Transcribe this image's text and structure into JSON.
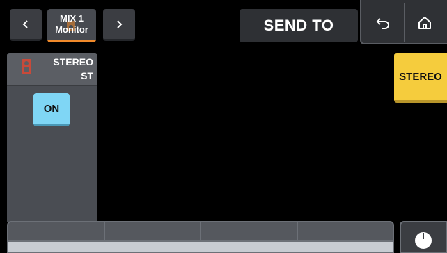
{
  "header": {
    "channel_line1": "MIX 1",
    "channel_line2": "Monitor",
    "title": "SEND TO"
  },
  "icons": {
    "prev": "chevron-left-icon",
    "next": "chevron-right-icon",
    "back": "undo-arrow-icon",
    "home": "home-icon",
    "speaker": "speaker-icon",
    "knob": "knob-icon"
  },
  "send_panel": {
    "name": "STEREO",
    "sub": "ST",
    "on_label": "ON"
  },
  "stereo_button": {
    "label": "STEREO"
  },
  "colors": {
    "accent_orange": "#f08a2b",
    "on_blue": "#7fd6f5",
    "stereo_yellow": "#f5cc3d"
  }
}
